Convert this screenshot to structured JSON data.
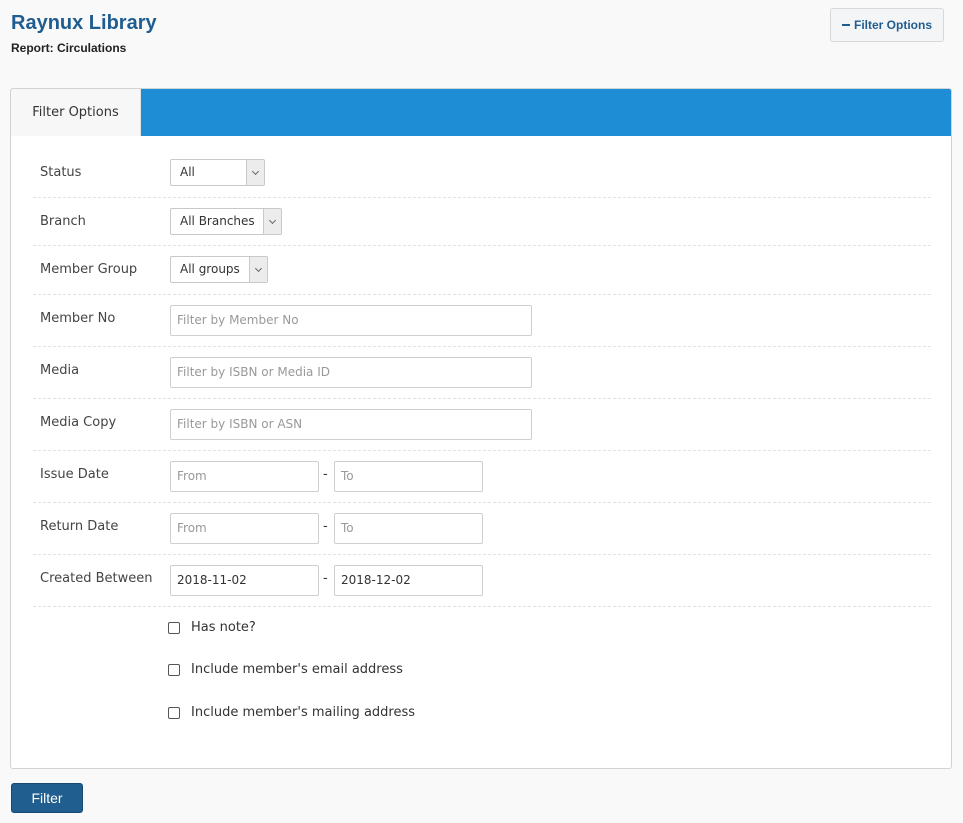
{
  "header": {
    "title": "Raynux Library",
    "report": "Report: Circulations",
    "toggle_label": "Filter Options",
    "toggle_icon": "minus-icon"
  },
  "panel": {
    "tab_label": "Filter Options",
    "accent_color": "#1e8dd6"
  },
  "filters": {
    "status": {
      "label": "Status",
      "value": "All"
    },
    "branch": {
      "label": "Branch",
      "value": "All Branches"
    },
    "member_group": {
      "label": "Member Group",
      "value": "All groups"
    },
    "member_no": {
      "label": "Member No",
      "placeholder": "Filter by Member No"
    },
    "media": {
      "label": "Media",
      "placeholder": "Filter by ISBN or Media ID"
    },
    "media_copy": {
      "label": "Media Copy",
      "placeholder": "Filter by ISBN or ASN"
    },
    "issue_date": {
      "label": "Issue Date",
      "from_placeholder": "From",
      "to_placeholder": "To",
      "separator": "-"
    },
    "return_date": {
      "label": "Return Date",
      "from_placeholder": "From",
      "to_placeholder": "To",
      "separator": "-"
    },
    "created_between": {
      "label": "Created Between",
      "from_value": "2018-11-02",
      "to_value": "2018-12-02",
      "separator": "-"
    }
  },
  "options": {
    "has_note": "Has note?",
    "include_email": "Include member's email address",
    "include_mailing": "Include member's mailing address"
  },
  "actions": {
    "filter_label": "Filter"
  }
}
